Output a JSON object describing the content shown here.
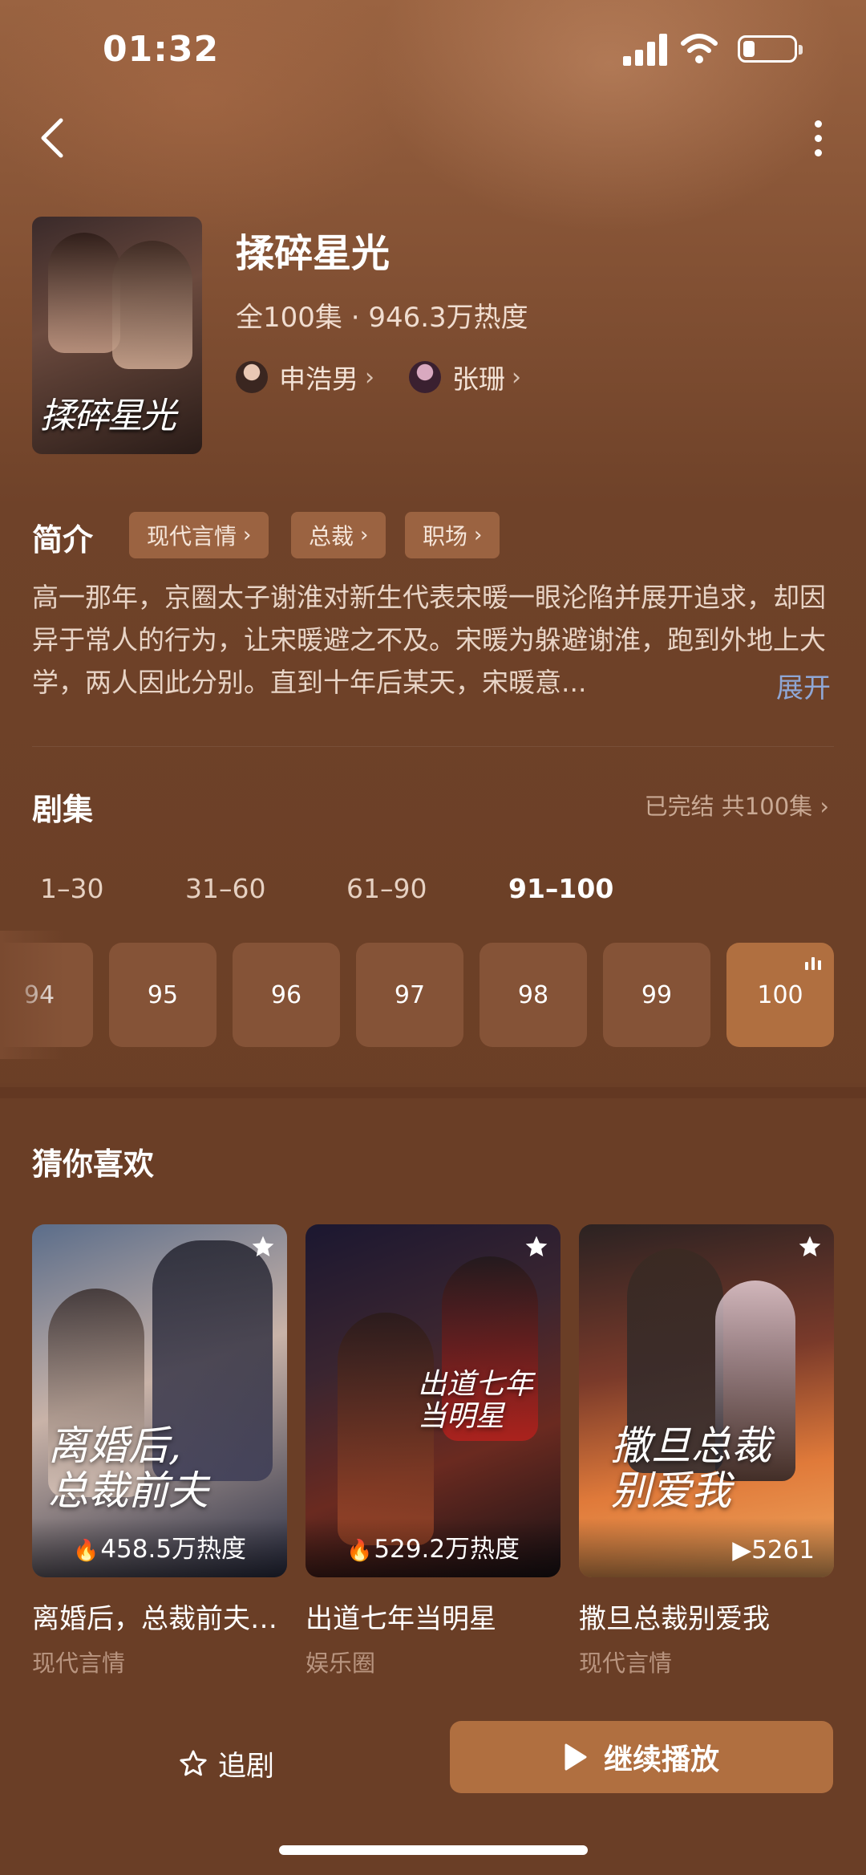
{
  "status_bar": {
    "time": "01:32"
  },
  "show": {
    "poster_title": "揉碎星光",
    "title": "揉碎星光",
    "meta": "全100集 · 946.3万热度",
    "actors": [
      {
        "name": "申浩男"
      },
      {
        "name": "张珊"
      }
    ]
  },
  "intro": {
    "label": "简介",
    "tags": [
      "现代言情",
      "总裁",
      "职场"
    ],
    "synopsis": "高一那年，京圈太子谢淮对新生代表宋暖一眼沦陷并展开追求，却因异于常人的行为，让宋暖避之不及。宋暖为躲避谢淮，跑到外地上大学，两人因此分别。直到十年后某天，宋暖意...",
    "expand_label": "展开"
  },
  "episodes": {
    "label": "剧集",
    "status": "已完结 共100集",
    "ranges": [
      "1–30",
      "31–60",
      "61–90",
      "91–100"
    ],
    "active_range": "91–100",
    "items": [
      "94",
      "95",
      "96",
      "97",
      "98",
      "99",
      "100"
    ],
    "current": "100"
  },
  "recommend": {
    "label": "猜你喜欢",
    "items": [
      {
        "art_title": "离婚后,\n总裁前夫",
        "heat": "458.5万热度",
        "title": "离婚后，总裁前夫…",
        "genre": "现代言情"
      },
      {
        "art_title": "出道七年\n当明星",
        "heat": "529.2万热度",
        "title": "出道七年当明星",
        "genre": "娱乐圈"
      },
      {
        "art_title": "撒旦总裁\n别爱我",
        "heat": "5261",
        "title": "撒旦总裁别爱我",
        "genre": "现代言情"
      }
    ]
  },
  "bottom_bar": {
    "follow_label": "追剧",
    "play_label": "继续播放"
  },
  "colors": {
    "accent": "#b06f40",
    "tag_bg": "#9b6341",
    "expand": "#8fa7d6"
  }
}
